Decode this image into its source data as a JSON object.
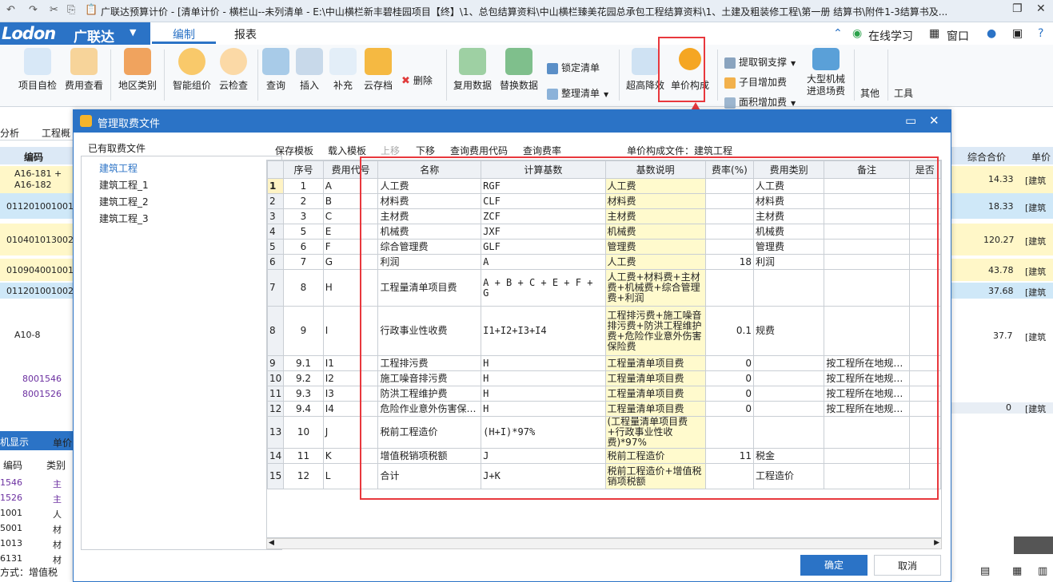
{
  "titlebar": {
    "title": "广联达预算计价 - [清单计价 - 横栏山--未列清单 - E:\\中山横栏新丰碧桂园项目【终】\\1、总包结算资料\\中山横栏臻美花园总承包工程结算资料\\1、土建及粗装修工程\\第一册  结算书\\附件1-3结算书及..."
  },
  "brand": {
    "logo": "Lodon",
    "name": "广联达"
  },
  "tabs": [
    "编制",
    "报表"
  ],
  "topright": {
    "study": "在线学习",
    "window": "窗口"
  },
  "ribbon": {
    "buttons": [
      "项目自检",
      "费用查看",
      "地区类别",
      "智能组价",
      "云检查",
      "查询",
      "插入",
      "补充",
      "云存档",
      "复用数据",
      "替换数据",
      "超高降效",
      "单价构成",
      "大型机械\n进退场费",
      "其他",
      "工具"
    ],
    "small": {
      "delete": "删除",
      "lock": "锁定清单",
      "organize": "整理清单",
      "steel": "提取钢支撑",
      "subitem": "子目增加费",
      "area": "面积增加费"
    }
  },
  "background": {
    "left_tabs": [
      "分析",
      "工程概"
    ],
    "code_header": "编码",
    "codes": [
      "A16-181 +\nA16-182",
      "011201001001",
      "010401013002",
      "010904001001",
      "011201001002",
      "A10-8",
      "8001546",
      "8001526"
    ],
    "bottom_tab": "机显示",
    "bottom_tab2": "单价",
    "bottom_headers": [
      "编码",
      "类别"
    ],
    "bottom_rows": [
      [
        "1546",
        "主"
      ],
      [
        "1526",
        "主"
      ],
      [
        "1001",
        "人"
      ],
      [
        "5001",
        "材"
      ],
      [
        "1013",
        "材"
      ],
      [
        "6131",
        "材"
      ]
    ],
    "status": "方式：增值税",
    "right_header": [
      "综合合价",
      "单价"
    ],
    "right_values": [
      [
        "14.33",
        "[建筑"
      ],
      [
        "18.33",
        "[建筑"
      ],
      [
        "120.27",
        "[建筑"
      ],
      [
        "43.78",
        "[建筑"
      ],
      [
        "37.68",
        "[建筑"
      ],
      [
        "37.7",
        "[建筑"
      ],
      [
        "0",
        "[建筑"
      ]
    ]
  },
  "dialog": {
    "title": "管理取费文件",
    "left_label": "已有取费文件",
    "files": [
      "建筑工程",
      "建筑工程_1",
      "建筑工程_2",
      "建筑工程_3"
    ],
    "toolbar": [
      "保存模板",
      "载入模板",
      "上移",
      "下移",
      "查询费用代码",
      "查询费率"
    ],
    "current_file_label": "单价构成文件：建筑工程",
    "columns": [
      "序号",
      "费用代号",
      "名称",
      "计算基数",
      "基数说明",
      "费率(%)",
      "费用类别",
      "备注",
      "是否"
    ],
    "rows": [
      {
        "rn": "1",
        "seq": "1",
        "code": "A",
        "name": "人工费",
        "base": "RGF",
        "desc": "人工费",
        "rate": "",
        "cat": "人工费",
        "note": ""
      },
      {
        "rn": "2",
        "seq": "2",
        "code": "B",
        "name": "材料费",
        "base": "CLF",
        "desc": "材料费",
        "rate": "",
        "cat": "材料费",
        "note": ""
      },
      {
        "rn": "3",
        "seq": "3",
        "code": "C",
        "name": "主材费",
        "base": "ZCF",
        "desc": "主材费",
        "rate": "",
        "cat": "主材费",
        "note": ""
      },
      {
        "rn": "4",
        "seq": "5",
        "code": "E",
        "name": "机械费",
        "base": "JXF",
        "desc": "机械费",
        "rate": "",
        "cat": "机械费",
        "note": ""
      },
      {
        "rn": "5",
        "seq": "6",
        "code": "F",
        "name": "综合管理费",
        "base": "GLF",
        "desc": "管理费",
        "rate": "",
        "cat": "管理费",
        "note": ""
      },
      {
        "rn": "6",
        "seq": "7",
        "code": "G",
        "name": "利润",
        "base": "A",
        "desc": "人工费",
        "rate": "18",
        "cat": "利润",
        "note": ""
      },
      {
        "rn": "7",
        "seq": "8",
        "code": "H",
        "name": "工程量清单项目费",
        "base": "A + B + C  + E + F + G",
        "desc": "人工费+材料费+主材费+机械费+综合管理费+利润",
        "rate": "",
        "cat": "",
        "note": ""
      },
      {
        "rn": "8",
        "seq": "9",
        "code": "I",
        "name": "行政事业性收费",
        "base": "I1+I2+I3+I4",
        "desc": "工程排污费+施工噪音排污费+防洪工程维护费+危险作业意外伤害保险费",
        "rate": "0.1",
        "cat": "规费",
        "note": ""
      },
      {
        "rn": "9",
        "seq": "9.1",
        "code": "I1",
        "name": "工程排污费",
        "base": "H",
        "desc": "工程量清单项目费",
        "rate": "0",
        "cat": "",
        "note": "按工程所在地规…"
      },
      {
        "rn": "10",
        "seq": "9.2",
        "code": "I2",
        "name": "施工噪音排污费",
        "base": "H",
        "desc": "工程量清单项目费",
        "rate": "0",
        "cat": "",
        "note": "按工程所在地规…"
      },
      {
        "rn": "11",
        "seq": "9.3",
        "code": "I3",
        "name": "防洪工程维护费",
        "base": "H",
        "desc": "工程量清单项目费",
        "rate": "0",
        "cat": "",
        "note": "按工程所在地规…"
      },
      {
        "rn": "12",
        "seq": "9.4",
        "code": "I4",
        "name": "危险作业意外伤害保…",
        "base": "H",
        "desc": "工程量清单项目费",
        "rate": "0",
        "cat": "",
        "note": "按工程所在地规…"
      },
      {
        "rn": "13",
        "seq": "10",
        "code": "J",
        "name": "税前工程造价",
        "base": "(H+I)*97%",
        "desc": "(工程量清单项目费+行政事业性收费)*97%",
        "rate": "",
        "cat": "",
        "note": ""
      },
      {
        "rn": "14",
        "seq": "11",
        "code": "K",
        "name": "增值税销项税额",
        "base": "J",
        "desc": "税前工程造价",
        "rate": "11",
        "cat": "税金",
        "note": ""
      },
      {
        "rn": "15",
        "seq": "12",
        "code": "L",
        "name": "合计",
        "base": "J+K",
        "desc": "税前工程造价+增值税销项税额",
        "rate": "",
        "cat": "工程造价",
        "note": ""
      }
    ],
    "ok": "确定",
    "cancel": "取消"
  }
}
